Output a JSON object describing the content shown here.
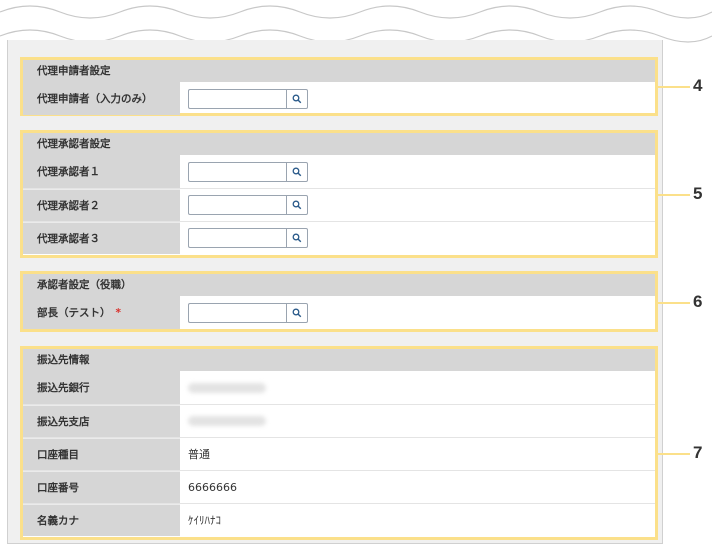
{
  "sections": {
    "proxy_applicant": {
      "title": "代理申請者設定",
      "rows": [
        {
          "label": "代理申請者（入力のみ）"
        }
      ]
    },
    "proxy_approver": {
      "title": "代理承認者設定",
      "rows": [
        {
          "label": "代理承認者１"
        },
        {
          "label": "代理承認者２"
        },
        {
          "label": "代理承認者３"
        }
      ]
    },
    "approver_role": {
      "title": "承認者設定（役職）",
      "rows": [
        {
          "label": "部長（テスト）",
          "required_mark": "*"
        }
      ]
    },
    "transfer_info": {
      "title": "振込先情報",
      "rows": [
        {
          "label": "振込先銀行",
          "value": ""
        },
        {
          "label": "振込先支店",
          "value": ""
        },
        {
          "label": "口座種目",
          "value": "普通"
        },
        {
          "label": "口座番号",
          "value": "6666666"
        },
        {
          "label": "名義カナ",
          "value": "ｹｲﾘﾊﾅｺ"
        }
      ]
    }
  },
  "callouts": [
    "4",
    "5",
    "6",
    "7"
  ],
  "colors": {
    "highlight": "#fbe08a",
    "header_bg": "#d6d6d6",
    "required": "#d9302b"
  },
  "icons": {
    "search": "magnifier-icon"
  }
}
